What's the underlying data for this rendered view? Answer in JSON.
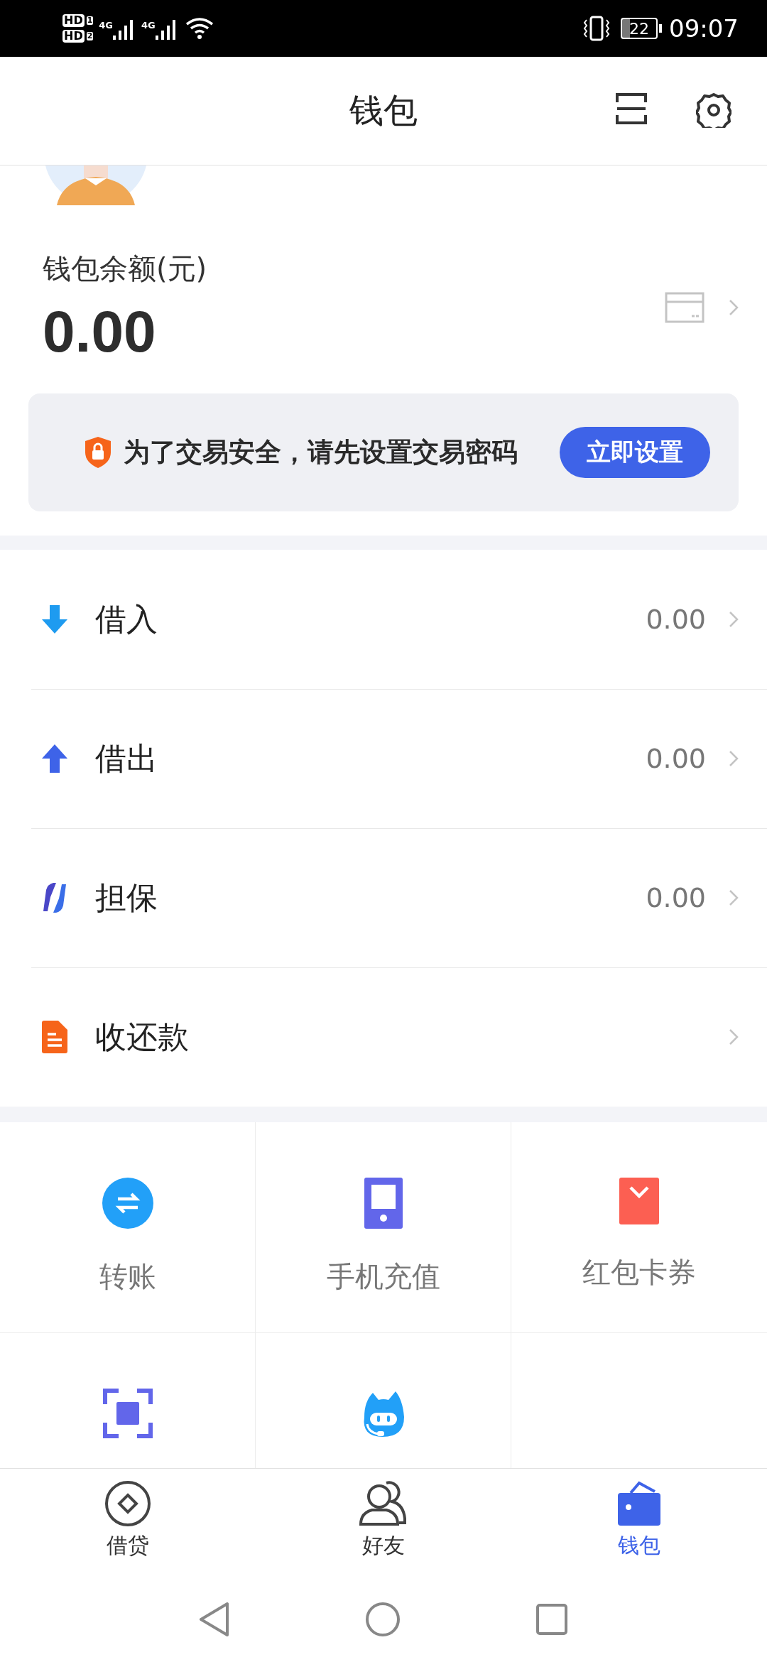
{
  "status_bar": {
    "sims": [
      {
        "label": "HD",
        "slot": "1"
      },
      {
        "label": "HD",
        "slot": "2"
      }
    ],
    "networks": [
      "4G",
      "4G"
    ],
    "battery": "22",
    "time": "09:07"
  },
  "header": {
    "title": "钱包"
  },
  "balance": {
    "label": "钱包余额(元)",
    "amount": "0.00"
  },
  "security_banner": {
    "message": "为了交易安全，请先设置交易密码",
    "button": "立即设置"
  },
  "ledger": [
    {
      "kind": "borrow-in",
      "label": "借入",
      "amount": "0.00"
    },
    {
      "kind": "borrow-out",
      "label": "借出",
      "amount": "0.00"
    },
    {
      "kind": "guarantee",
      "label": "担保",
      "amount": "0.00"
    },
    {
      "kind": "repay",
      "label": "收还款"
    }
  ],
  "services": [
    {
      "kind": "transfer",
      "label": "转账"
    },
    {
      "kind": "topup",
      "label": "手机充值"
    },
    {
      "kind": "coupon",
      "label": "红包卡券"
    },
    {
      "kind": "scan"
    },
    {
      "kind": "help"
    }
  ],
  "tabs": [
    {
      "kind": "loan",
      "label": "借贷",
      "selected": false
    },
    {
      "kind": "friends",
      "label": "好友",
      "selected": false
    },
    {
      "kind": "wallet",
      "label": "钱包",
      "selected": true
    }
  ]
}
